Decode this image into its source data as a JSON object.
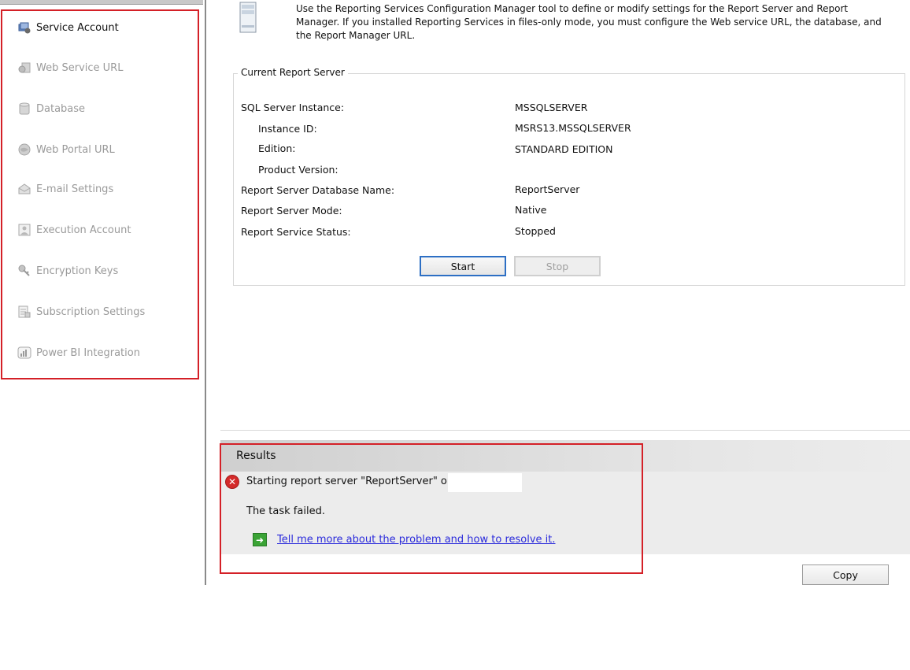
{
  "sidebar": {
    "items": [
      {
        "label": "Service Account",
        "icon": "service-account-icon",
        "active": true
      },
      {
        "label": "Web Service URL",
        "icon": "web-service-url-icon",
        "active": false
      },
      {
        "label": "Database",
        "icon": "database-icon",
        "active": false
      },
      {
        "label": "Web Portal URL",
        "icon": "globe-icon",
        "active": false
      },
      {
        "label": "E-mail Settings",
        "icon": "email-icon",
        "active": false
      },
      {
        "label": "Execution Account",
        "icon": "execution-account-icon",
        "active": false
      },
      {
        "label": "Encryption Keys",
        "icon": "keys-icon",
        "active": false
      },
      {
        "label": "Subscription Settings",
        "icon": "subscription-icon",
        "active": false
      },
      {
        "label": "Power BI Integration",
        "icon": "power-bi-icon",
        "active": false
      }
    ]
  },
  "intro": {
    "text": "Use the Reporting Services Configuration Manager tool to define or modify settings for the Report Server and Report Manager. If you installed Reporting Services in files-only mode, you must configure the Web service URL, the database, and the Report Manager URL."
  },
  "current_server": {
    "title": "Current Report Server",
    "rows": [
      {
        "label": "SQL Server Instance:",
        "value": "MSSQLSERVER"
      },
      {
        "label": "Instance ID:",
        "value": "MSRS13.MSSQLSERVER"
      },
      {
        "label": "Edition:",
        "value": "STANDARD EDITION"
      },
      {
        "label": "Product Version:",
        "value": ""
      },
      {
        "label": "Report Server Database Name:",
        "value": "ReportServer"
      },
      {
        "label": "Report Server Mode:",
        "value": "Native"
      },
      {
        "label": "Report Service Status:",
        "value": "Stopped"
      }
    ],
    "start_label": "Start",
    "stop_label": "Stop"
  },
  "results": {
    "title": "Results",
    "error_message": "Starting report server \"ReportServer\" on",
    "failure_text": "The task failed.",
    "help_link": "Tell me more about the problem and how to resolve it.",
    "copy_label": "Copy"
  },
  "colors": {
    "highlight_red": "#d42027",
    "accent_blue": "#2d6fc4",
    "link_blue": "#2a2adb",
    "error_red": "#d42a2a",
    "success_green": "#3aa335"
  }
}
